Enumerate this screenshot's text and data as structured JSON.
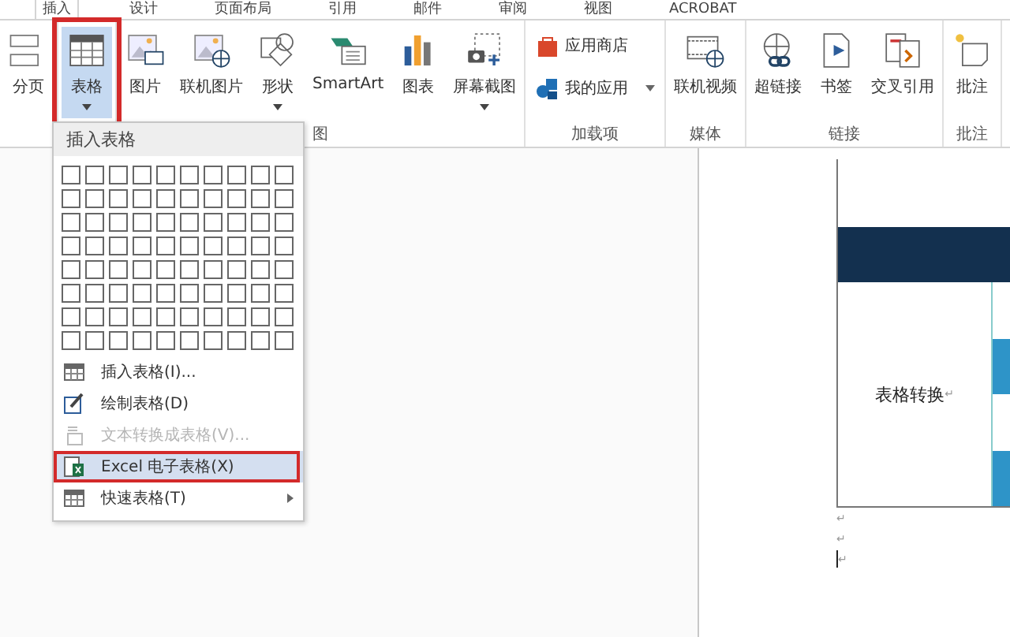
{
  "tabs": [
    {
      "label": "插入",
      "selected": true
    },
    {
      "label": "设计",
      "selected": false
    },
    {
      "label": "页面布局",
      "selected": false
    },
    {
      "label": "引用",
      "selected": false
    },
    {
      "label": "邮件",
      "selected": false
    },
    {
      "label": "审阅",
      "selected": false
    },
    {
      "label": "视图",
      "selected": false
    },
    {
      "label": "ACROBAT",
      "selected": false
    }
  ],
  "groups": [
    {
      "buttons": [
        {
          "label": "分页",
          "kind": "large",
          "dropdown": false,
          "selected": false,
          "annotated": false
        }
      ]
    },
    {
      "buttons": [
        {
          "label": "表格",
          "kind": "large",
          "dropdown": true,
          "selected": true,
          "annotated": true
        }
      ]
    },
    {
      "label": "图",
      "buttons": [
        {
          "label": "图片",
          "kind": "large",
          "dropdown": false,
          "selected": false,
          "annotated": false
        },
        {
          "label": "联机图片",
          "kind": "large",
          "dropdown": false,
          "selected": false,
          "annotated": false
        },
        {
          "label": "形状",
          "kind": "large",
          "dropdown": true,
          "selected": false,
          "annotated": false
        },
        {
          "label": "SmartArt",
          "kind": "large",
          "dropdown": false,
          "selected": false,
          "annotated": false
        },
        {
          "label": "图表",
          "kind": "large",
          "dropdown": false,
          "selected": false,
          "annotated": false
        },
        {
          "label": "屏幕截图",
          "kind": "large",
          "dropdown": true,
          "selected": false,
          "annotated": false
        }
      ]
    },
    {
      "label": "加载项",
      "buttons": [
        {
          "label": "应用商店",
          "kind": "small",
          "dropdown": false,
          "selected": false,
          "annotated": false
        },
        {
          "label": "我的应用",
          "kind": "small",
          "dropdown": true,
          "selected": false,
          "annotated": false
        }
      ]
    },
    {
      "label": "媒体",
      "buttons": [
        {
          "label": "联机视频",
          "kind": "large",
          "dropdown": false,
          "selected": false,
          "annotated": false
        }
      ]
    },
    {
      "label": "链接",
      "buttons": [
        {
          "label": "超链接",
          "kind": "large",
          "dropdown": false,
          "selected": false,
          "annotated": false
        },
        {
          "label": "书签",
          "kind": "large",
          "dropdown": false,
          "selected": false,
          "annotated": false
        },
        {
          "label": "交叉引用",
          "kind": "large",
          "dropdown": false,
          "selected": false,
          "annotated": false
        }
      ]
    },
    {
      "label": "批注",
      "buttons": [
        {
          "label": "批注",
          "kind": "large",
          "dropdown": false,
          "selected": false,
          "annotated": false
        }
      ]
    }
  ],
  "menu": {
    "header": "插入表格",
    "items": [
      {
        "label": "插入表格(I)...",
        "disabled": false,
        "highlighted": false,
        "annotated": false,
        "submenu": false
      },
      {
        "label": "绘制表格(D)",
        "disabled": false,
        "highlighted": false,
        "annotated": false,
        "submenu": false
      },
      {
        "label": "文本转换成表格(V)...",
        "disabled": true,
        "highlighted": false,
        "annotated": false,
        "submenu": false
      },
      {
        "label": "Excel 电子表格(X)",
        "disabled": false,
        "highlighted": true,
        "annotated": true,
        "submenu": false
      },
      {
        "label": "快速表格(T)",
        "disabled": false,
        "highlighted": false,
        "annotated": false,
        "submenu": true
      }
    ]
  },
  "document": {
    "cell_text": "表格转换",
    "cell_mark": "↵",
    "paragraph_marks": [
      "↵",
      "↵",
      "↵"
    ]
  }
}
